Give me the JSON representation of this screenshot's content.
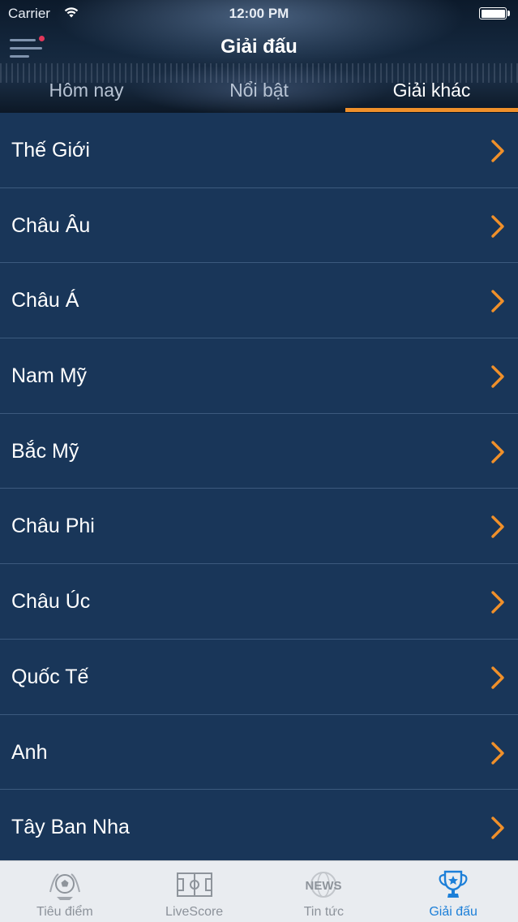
{
  "status_bar": {
    "carrier": "Carrier",
    "time": "12:00 PM"
  },
  "nav": {
    "title": "Giải đấu"
  },
  "tabs": [
    {
      "label": "Hôm nay",
      "active": false
    },
    {
      "label": "Nổi bật",
      "active": false
    },
    {
      "label": "Giải khác",
      "active": true
    }
  ],
  "regions": [
    {
      "label": "Thế Giới"
    },
    {
      "label": "Châu Âu"
    },
    {
      "label": "Châu Á"
    },
    {
      "label": "Nam Mỹ"
    },
    {
      "label": "Bắc Mỹ"
    },
    {
      "label": "Châu Phi"
    },
    {
      "label": "Châu Úc"
    },
    {
      "label": "Quốc Tế"
    },
    {
      "label": "Anh"
    },
    {
      "label": "Tây Ban Nha"
    }
  ],
  "tabbar": [
    {
      "label": "Tiêu điểm",
      "icon": "soccer-ball-icon",
      "active": false
    },
    {
      "label": "LiveScore",
      "icon": "pitch-icon",
      "active": false
    },
    {
      "label": "Tin tức",
      "icon": "news-globe-icon",
      "active": false
    },
    {
      "label": "Giải đấu",
      "icon": "trophy-icon",
      "active": true
    }
  ],
  "colors": {
    "accent": "#f0902a",
    "list_background": "#193659",
    "tabbar_active": "#1c7fd8"
  }
}
